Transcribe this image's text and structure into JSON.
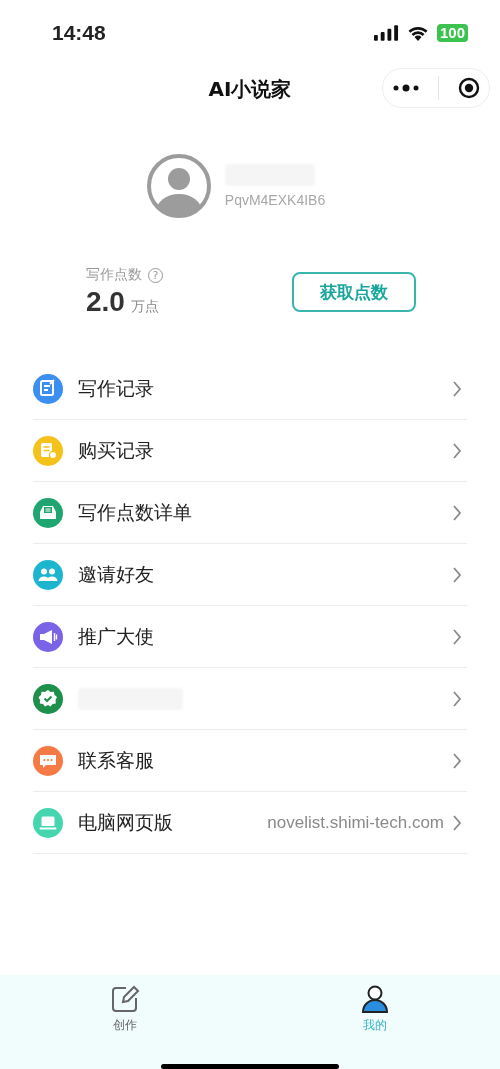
{
  "status_bar": {
    "time": "14:48",
    "battery": "100"
  },
  "nav": {
    "title": "AI小说家"
  },
  "profile": {
    "user_id": "PqvM4EXK4IB6"
  },
  "points": {
    "label": "写作点数",
    "help": "?",
    "value": "2.0",
    "unit": "万点",
    "button": "获取点数"
  },
  "menu": [
    {
      "kind": "edit",
      "color": "#3a8ff0",
      "label": "写作记录"
    },
    {
      "kind": "receipt",
      "color": "#f5c21b",
      "label": "购买记录"
    },
    {
      "kind": "tray",
      "color": "#1fa56f",
      "label": "写作点数详单"
    },
    {
      "kind": "people",
      "color": "#1cb5cf",
      "label": "邀请好友"
    },
    {
      "kind": "megaphone",
      "color": "#7b63e8",
      "label": "推广大使"
    },
    {
      "kind": "badge",
      "color": "#1f8f4c"
    },
    {
      "kind": "chat",
      "color": "#f57a45",
      "label": "联系客服"
    },
    {
      "kind": "laptop",
      "color": "#45d6b0",
      "label": "电脑网页版",
      "value": "novelist.shimi-tech.com"
    }
  ],
  "tabs": [
    {
      "kind": "create",
      "label": "创作",
      "selected": false
    },
    {
      "kind": "me",
      "label": "我的",
      "selected": true
    }
  ]
}
